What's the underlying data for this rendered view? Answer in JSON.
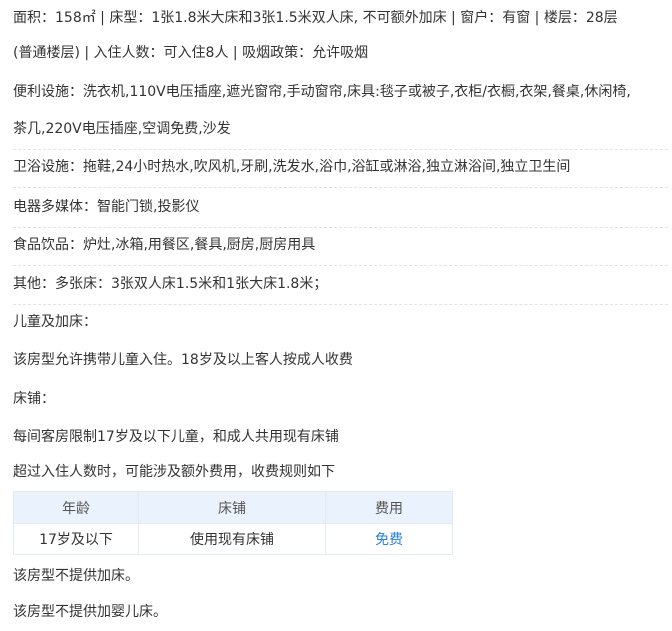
{
  "room": {
    "line1": "面积：158㎡ | 床型：1张1.8米大床和3张1.5米双人床, 不可额外加床 | 窗户：有窗 | 楼层：28层",
    "line2": "(普通楼层) | 入住人数：可入住8人 | 吸烟政策：允许吸烟"
  },
  "amenities": {
    "convenience_label": "便利设施：",
    "convenience_line1": "洗衣机,110V电压插座,遮光窗帘,手动窗帘,床具:毯子或被子,衣柜/衣橱,衣架,餐桌,休闲椅,",
    "convenience_line2": "茶几,220V电压插座,空调免费,沙发",
    "bath_label": "卫浴设施：",
    "bath_value": "拖鞋,24小时热水,吹风机,牙刷,洗发水,浴巾,浴缸或淋浴,独立淋浴间,独立卫生间",
    "media_label": "电器多媒体：",
    "media_value": "智能门锁,投影仪",
    "food_label": "食品饮品：",
    "food_value": "炉灶,冰箱,用餐区,餐具,厨房,厨房用具",
    "other_label": "其他：",
    "other_value": "多张床：3张双人床1.5米和1张大床1.8米；"
  },
  "children": {
    "heading": "儿童及加床：",
    "policy": "该房型允许携带儿童入住。18岁及以上客人按成人收费",
    "bed_heading": "床铺：",
    "bed_rule": "每间客房限制17岁及以下儿童，和成人共用现有床铺",
    "extra_rule": "超过入住人数时，可能涉及额外费用，收费规则如下",
    "table": {
      "headers": [
        "年龄",
        "床铺",
        "费用"
      ],
      "rows": [
        [
          "17岁及以下",
          "使用现有床铺",
          "免费"
        ]
      ]
    },
    "no_extra_bed": "该房型不提供加床。",
    "no_crib": "该房型不提供加婴儿床。"
  },
  "colors": {
    "text": "#333333",
    "table_header_bg": "#eaf3fd",
    "free_text": "#2b82d8",
    "divider": "#e3e3e3"
  }
}
